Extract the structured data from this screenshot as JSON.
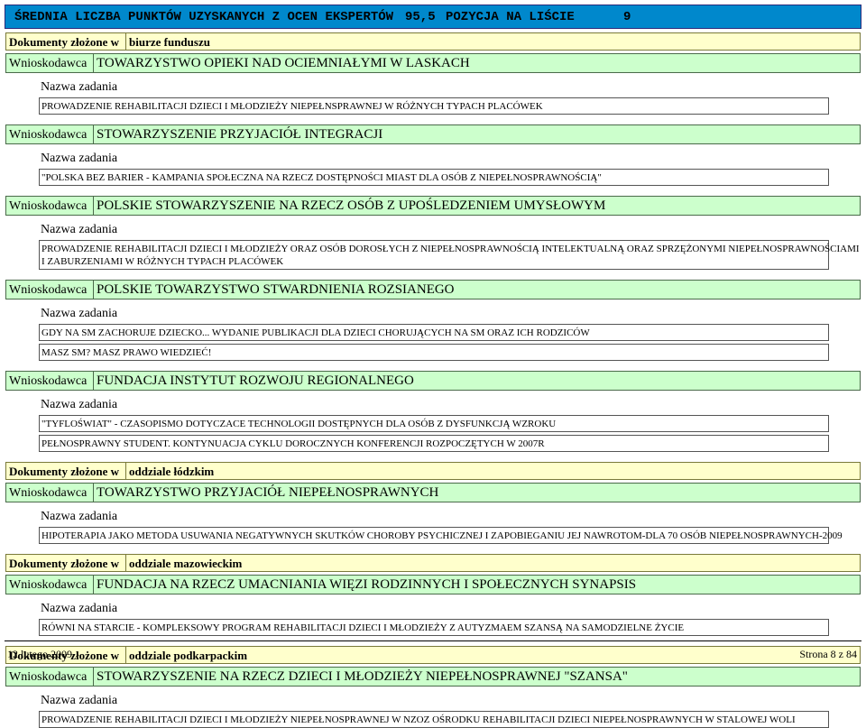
{
  "header": {
    "title": "ŚREDNIA LICZBA PUNKTÓW UZYSKANYCH Z OCEN EKSPERTÓW",
    "score": "95,5",
    "position_label": "POZYCJA NA LIŚCIE",
    "position_value": "9"
  },
  "labels": {
    "dokumenty": "Dokumenty złożone w",
    "wnioskodawca": "Wnioskodawca",
    "nazwa_zadania": "Nazwa zadania"
  },
  "sections": [
    {
      "office": "biurze funduszu",
      "applicants": [
        {
          "name": "TOWARZYSTWO OPIEKI NAD OCIEMNIAŁYMI W LASKACH",
          "tasks": [
            {
              "lines": [
                "PROWADZENIE REHABILITACJI DZIECI I MŁODZIEŻY NIEPEŁNSPRAWNEJ W RÓŻNYCH TYPACH PLACÓWEK"
              ]
            }
          ]
        },
        {
          "name": "STOWARZYSZENIE PRZYJACIÓŁ INTEGRACJI",
          "tasks": [
            {
              "lines": [
                "\"POLSKA BEZ BARIER - KAMPANIA SPOŁECZNA NA RZECZ DOSTĘPNOŚCI MIAST DLA OSÓB Z NIEPEŁNOSPRAWNOŚCIĄ\""
              ]
            }
          ]
        },
        {
          "name": "POLSKIE STOWARZYSZENIE NA RZECZ OSÓB Z UPOŚLEDZENIEM UMYSŁOWYM",
          "tasks": [
            {
              "lines": [
                "PROWADZENIE REHABILITACJI DZIECI I MŁODZIEŻY ORAZ OSÓB DOROSŁYCH Z NIEPEŁNOSPRAWNOŚCIĄ INTELEKTUALNĄ ORAZ SPRZĘŻONYMI NIEPEŁNOSPRAWNOŚCIAMI",
                "I ZABURZENIAMI W RÓŻNYCH TYPACH PLACÓWEK"
              ]
            }
          ]
        },
        {
          "name": "POLSKIE TOWARZYSTWO STWARDNIENIA ROZSIANEGO",
          "tasks": [
            {
              "lines": [
                "GDY NA SM ZACHORUJE DZIECKO... WYDANIE PUBLIKACJI DLA DZIECI CHORUJĄCYCH NA SM ORAZ ICH RODZICÓW"
              ]
            },
            {
              "lines": [
                "MASZ SM? MASZ PRAWO WIEDZIEĆ!"
              ]
            }
          ]
        },
        {
          "name": "FUNDACJA INSTYTUT ROZWOJU REGIONALNEGO",
          "tasks": [
            {
              "lines": [
                "\"TYFLOŚWIAT\" - CZASOPISMO DOTYCZACE TECHNOLOGII DOSTĘPNYCH DLA OSÓB Z DYSFUNKCJĄ WZROKU"
              ]
            },
            {
              "lines": [
                "PEŁNOSPRAWNY STUDENT. KONTYNUACJA CYKLU DOROCZNYCH KONFERENCJI ROZPOCZĘTYCH W 2007R"
              ]
            }
          ]
        }
      ]
    },
    {
      "office": "oddziale łódzkim",
      "applicants": [
        {
          "name": "TOWARZYSTWO PRZYJACIÓŁ NIEPEŁNOSPRAWNYCH",
          "tasks": [
            {
              "lines": [
                "HIPOTERAPIA JAKO METODA USUWANIA NEGATYWNYCH SKUTKÓW CHOROBY PSYCHICZNEJ I ZAPOBIEGANIU JEJ NAWROTOM-DLA 70 OSÓB NIEPEŁNOSPRAWNYCH-2009"
              ]
            }
          ]
        }
      ]
    },
    {
      "office": "oddziale mazowieckim",
      "applicants": [
        {
          "name": "FUNDACJA NA RZECZ UMACNIANIA WIĘZI RODZINNYCH I SPOŁECZNYCH SYNAPSIS",
          "tasks": [
            {
              "lines": [
                "RÓWNI NA STARCIE - KOMPLEKSOWY PROGRAM REHABILITACJI DZIECI I MŁODZIEŻY Z AUTYZMAEM SZANSĄ NA SAMODZIELNE ŻYCIE"
              ]
            }
          ]
        }
      ]
    },
    {
      "office": "oddziale podkarpackim",
      "applicants": [
        {
          "name": "STOWARZYSZENIE NA RZECZ DZIECI I MŁODZIEŻY NIEPEŁNOSPRAWNEJ \"SZANSA\"",
          "tasks": [
            {
              "lines": [
                "PROWADZENIE REHABILITACJI DZIECI I MŁODZIEŻY NIEPEŁNOSPRAWNEJ W NZOZ OŚRODKU REHABILITACJI DZIECI NIEPEŁNOSPRAWNYCH W STALOWEJ WOLI"
              ]
            }
          ]
        }
      ]
    }
  ],
  "footer": {
    "date": "12 lutego 2009",
    "page": "Strona 8 z 84"
  }
}
